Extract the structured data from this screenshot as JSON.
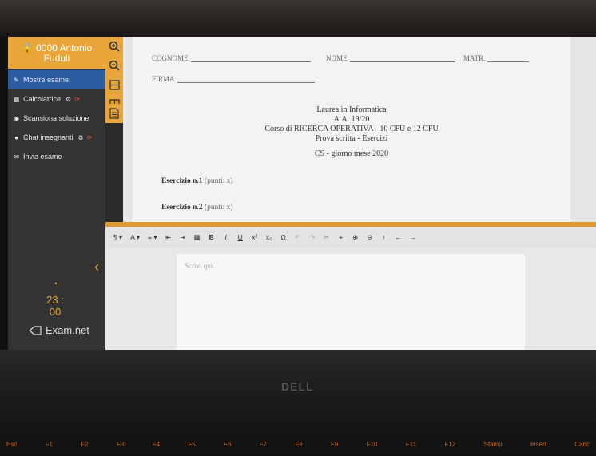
{
  "sidebar": {
    "user": "0000 Antonio Fuduli",
    "items": [
      {
        "label": "Mostra esame",
        "icon": "edit-icon",
        "active": true
      },
      {
        "label": "Calcolatrice",
        "icon": "calculator-icon",
        "extras": [
          "settings-icon",
          "refresh-icon"
        ]
      },
      {
        "label": "Scansiona soluzione",
        "icon": "camera-icon"
      },
      {
        "label": "Chat insegnanti",
        "icon": "chat-icon",
        "extras": [
          "settings-icon",
          "refresh-icon"
        ]
      },
      {
        "label": "Invia esame",
        "icon": "send-icon"
      }
    ],
    "timer": "23 : 00",
    "brand": "Exam.net"
  },
  "tools": [
    "zoom-in-icon",
    "zoom-out-icon",
    "layout-horizontal-icon",
    "layout-vertical-icon",
    "document-icon"
  ],
  "doc": {
    "cognome": "COGNOME",
    "nome": "NOME",
    "matr": "MATR.",
    "firma": "FIRMA",
    "header": [
      "Laurea in Informatica",
      "A.A. 19/20",
      "Corso di RICERCA OPERATIVA - 10 CFU e 12 CFU",
      "Prova scritta - Esercizi"
    ],
    "subtitle": "CS - giorno mese 2020",
    "exercises": [
      {
        "title": "Esercizio n.1",
        "points": "(punti: x)"
      },
      {
        "title": "Esercizio n.2",
        "points": "(punti: x)"
      }
    ]
  },
  "toolbar": [
    "¶ ▾",
    "A ▾",
    "≡ ▾",
    "⇤",
    "⇥",
    "▦",
    "B",
    "I",
    "U",
    "x²",
    "x₂",
    "Ω",
    "↶",
    "↷",
    "✂",
    "⌖",
    "⊕",
    "⊖",
    "↑",
    "←",
    "→"
  ],
  "editor": {
    "placeholder": "Scrivi qui..."
  },
  "laptop": {
    "brand": "DELL",
    "keys": [
      "Esc",
      "F1",
      "F2",
      "F3",
      "F4",
      "F5",
      "F6",
      "F7",
      "F8",
      "F9",
      "F10",
      "F11",
      "F12",
      "Stamp",
      "Insert",
      "Canc"
    ]
  }
}
